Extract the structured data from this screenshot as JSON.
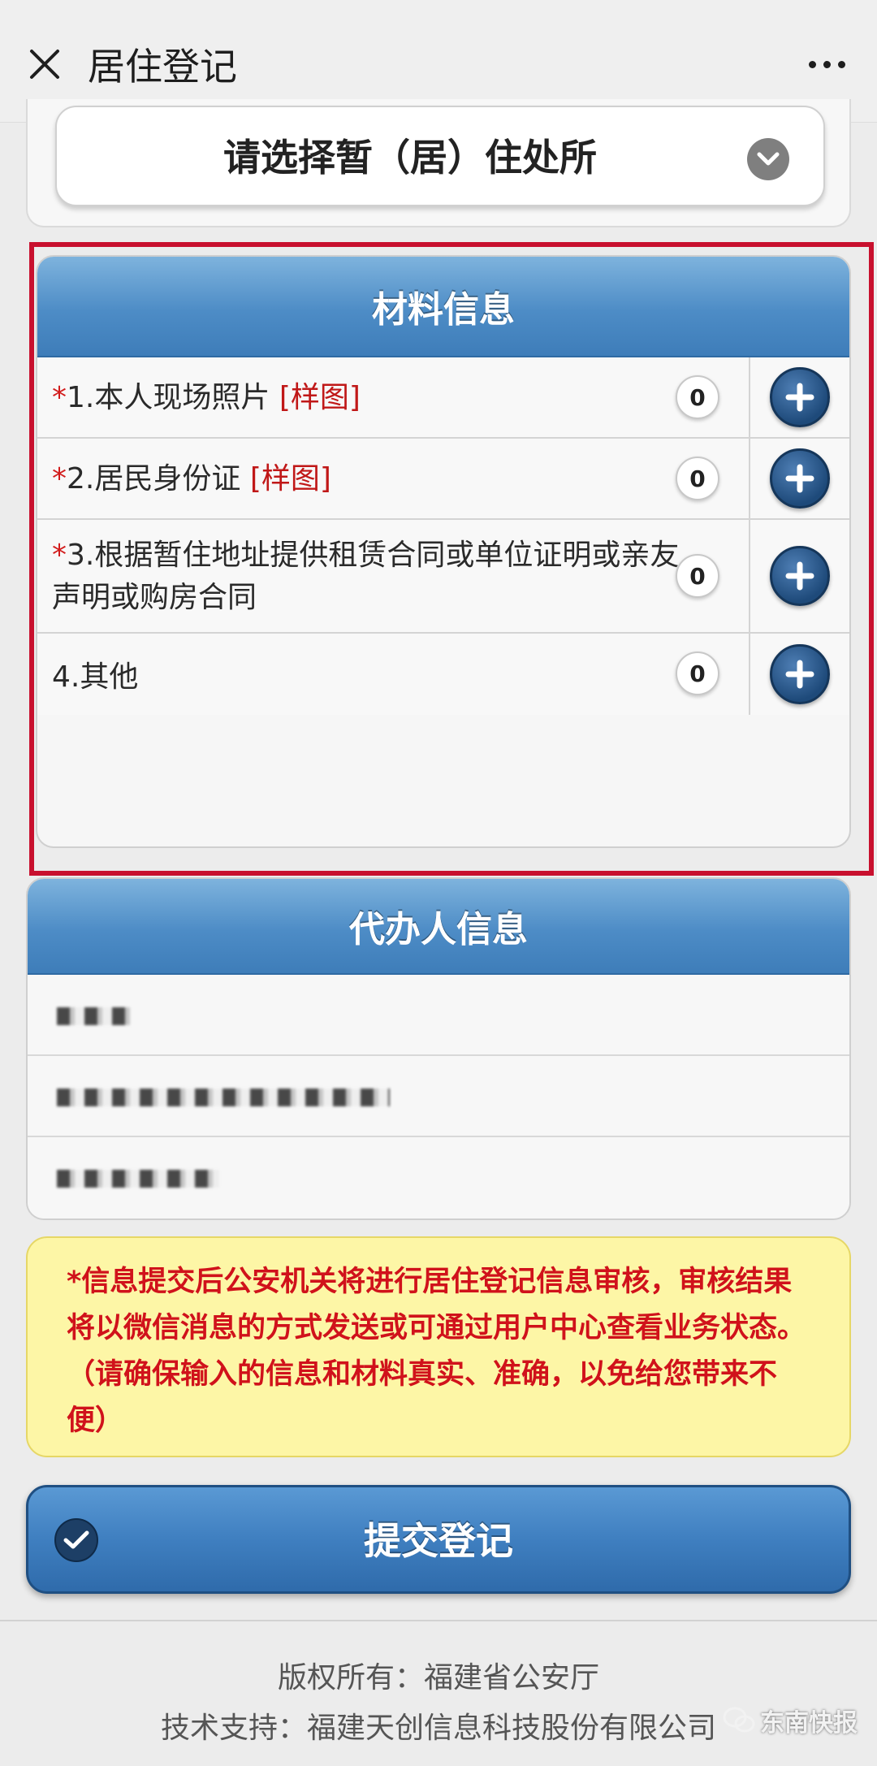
{
  "topbar": {
    "title": "居住登记"
  },
  "address_select": {
    "placeholder": "请选择暂（居）住处所"
  },
  "materials": {
    "title": "材料信息",
    "items": [
      {
        "required": "*",
        "label": "1.本人现场照片",
        "sample": "[样图]",
        "count": "0"
      },
      {
        "required": "*",
        "label": "2.居民身份证",
        "sample": "[样图]",
        "count": "0"
      },
      {
        "required": "*",
        "label": "3.根据暂住地址提供租赁合同或单位证明或亲友声明或购房合同",
        "sample": "",
        "count": "0"
      },
      {
        "required": "",
        "label": "4.其他",
        "sample": "",
        "count": "0"
      }
    ]
  },
  "agent": {
    "title": "代办人信息"
  },
  "notice": {
    "text": "*信息提交后公安机关将进行居住登记信息审核，审核结果将以微信消息的方式发送或可通过用户中心查看业务状态。（请确保输入的信息和材料真实、准确，以免给您带来不便）"
  },
  "submit": {
    "label": "提交登记"
  },
  "footer": {
    "copyright": "版权所有：福建省公安厅",
    "support": "技术支持：福建天创信息科技股份有限公司"
  },
  "watermark": "东南快报",
  "colors": {
    "accent_blue": "#4d8cc6",
    "highlight_red": "#c8102e",
    "notice_red": "#d0121b",
    "notice_bg": "#fdf6a6"
  }
}
